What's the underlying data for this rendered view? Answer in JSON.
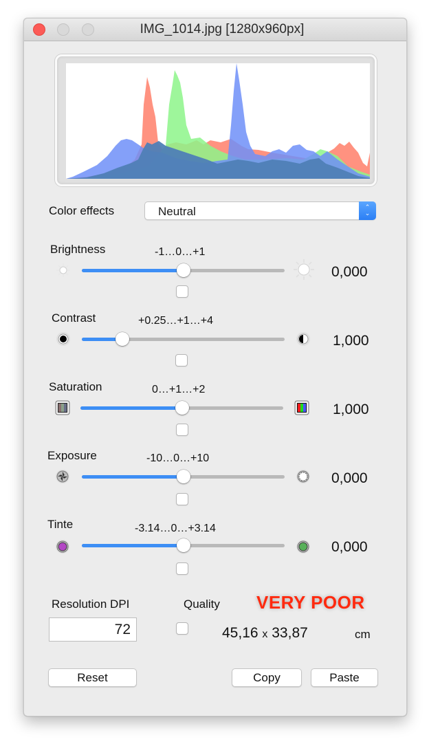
{
  "window": {
    "title": "IMG_1014.jpg [1280x960px]"
  },
  "histogram": {
    "channels": [
      {
        "name": "red",
        "color": "#ff7f6a"
      },
      {
        "name": "green",
        "color": "#8df48a"
      },
      {
        "name": "blue",
        "color": "#6f8ff8"
      },
      {
        "name": "luminance",
        "color": "#4f7fb6"
      }
    ]
  },
  "color_effects": {
    "label": "Color effects",
    "selected": "Neutral"
  },
  "sliders": [
    {
      "key": "brightness",
      "label": "Brightness",
      "range": "-1…0…+1",
      "value": "0,000",
      "position": 0.5,
      "min_icon": "sun-small-icon",
      "max_icon": "sun-large-icon",
      "checked": false
    },
    {
      "key": "contrast",
      "label": "Contrast",
      "range": "+0.25…+1…+4",
      "value": "1,000",
      "position": 0.2,
      "min_icon": "contrast-low-icon",
      "max_icon": "contrast-high-icon",
      "checked": false
    },
    {
      "key": "saturation",
      "label": "Saturation",
      "range": "0…+1…+2",
      "value": "1,000",
      "position": 0.5,
      "min_icon": "desaturated-icon",
      "max_icon": "saturated-icon",
      "checked": false
    },
    {
      "key": "exposure",
      "label": "Exposure",
      "range": "-10…0…+10",
      "value": "0,000",
      "position": 0.5,
      "min_icon": "aperture-closed-icon",
      "max_icon": "aperture-open-icon",
      "checked": false
    },
    {
      "key": "tint",
      "label": "Tinte",
      "range": "-3.14…0…+3.14",
      "value": "0,000",
      "position": 0.5,
      "min_icon": "tint-magenta-icon",
      "max_icon": "tint-green-icon",
      "checked": false
    }
  ],
  "resolution": {
    "label": "Resolution DPI",
    "value": "72"
  },
  "quality": {
    "label": "Quality",
    "status": "VERY POOR",
    "status_color": "#ff2a0f",
    "checked": false
  },
  "print_size": {
    "width": "45,16",
    "separator": "x",
    "height": "33,87",
    "unit": "cm"
  },
  "buttons": {
    "reset": "Reset",
    "copy": "Copy",
    "paste": "Paste"
  }
}
